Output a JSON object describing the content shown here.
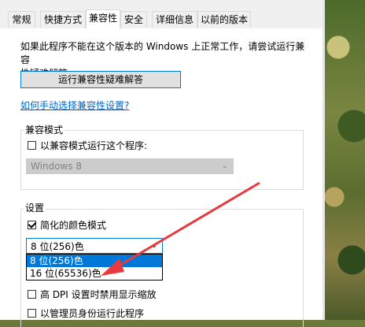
{
  "tabs": [
    {
      "label": "常规",
      "active": false
    },
    {
      "label": "快捷方式",
      "active": false
    },
    {
      "label": "兼容性",
      "active": true
    },
    {
      "label": "安全",
      "active": false
    },
    {
      "label": "详细信息",
      "active": false
    },
    {
      "label": "以前的版本",
      "active": false
    }
  ],
  "compat": {
    "description_line1": "如果此程序不能在这个版本的 Windows 上正常工作，请尝试运行兼容",
    "description_line2": "性疑难解答。",
    "troubleshoot_button": "运行兼容性疑难解答",
    "manual_link": "如何手动选择兼容性设置?"
  },
  "compat_mode": {
    "group_title": "兼容模式",
    "checkbox_label": "以兼容模式运行这个程序:",
    "checked": false,
    "select_value": "Windows 8"
  },
  "settings": {
    "group_title": "设置",
    "reduced_color_label": "简化的颜色模式",
    "reduced_color_checked": true,
    "color_select_value": "8 位(256)色",
    "color_options": [
      "8 位(256)色",
      "16 位(65536)色"
    ],
    "high_dpi_label": "高 DPI 设置时禁用显示缩放",
    "high_dpi_checked": false,
    "admin_label": "以管理员身份运行此程序",
    "admin_checked": false
  },
  "colors": {
    "accent": "#0078d7",
    "annotation_arrow": "#e8393f",
    "link": "#0066cc"
  }
}
